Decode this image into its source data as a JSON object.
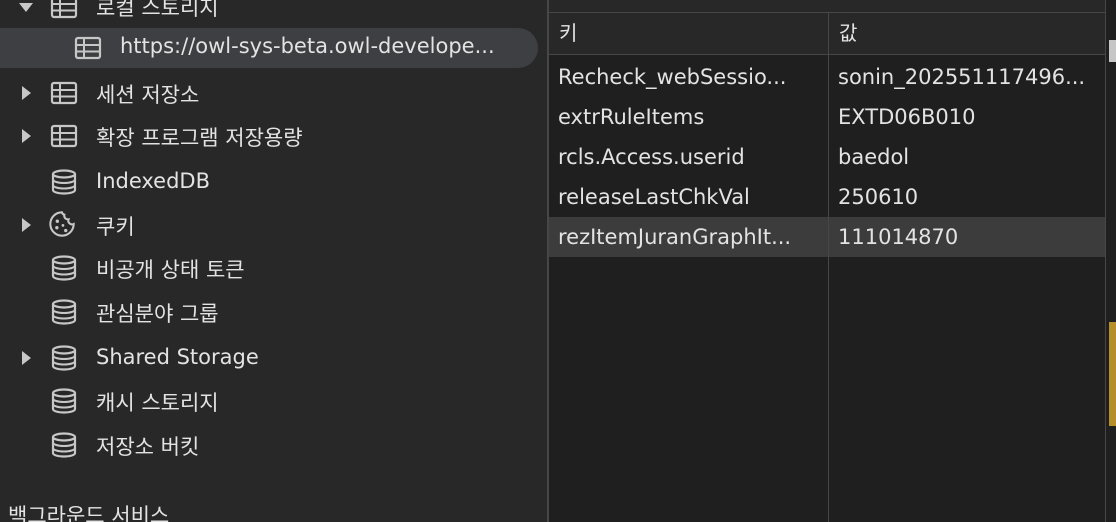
{
  "sidebar": {
    "items": [
      {
        "label": "로컬 스토리지",
        "icon": "table-icon",
        "expander": "down"
      },
      {
        "label": "https://owl-sys-beta.owl-develope...",
        "icon": "table-icon",
        "expander": "none"
      },
      {
        "label": "세션 저장소",
        "icon": "table-icon",
        "expander": "right"
      },
      {
        "label": "확장 프로그램 저장용량",
        "icon": "table-icon",
        "expander": "right"
      },
      {
        "label": "IndexedDB",
        "icon": "database-icon",
        "expander": "none"
      },
      {
        "label": "쿠키",
        "icon": "cookie-icon",
        "expander": "right"
      },
      {
        "label": "비공개 상태 토큰",
        "icon": "database-icon",
        "expander": "none"
      },
      {
        "label": "관심분야 그룹",
        "icon": "database-icon",
        "expander": "none"
      },
      {
        "label": "Shared Storage",
        "icon": "database-icon",
        "expander": "right"
      },
      {
        "label": "캐시 스토리지",
        "icon": "database-icon",
        "expander": "none"
      },
      {
        "label": "저장소 버킷",
        "icon": "database-icon",
        "expander": "none"
      }
    ],
    "section_title": "백그라운드 서비스"
  },
  "table": {
    "columns": [
      "키",
      "값"
    ],
    "rows": [
      {
        "key": "Recheck_webSessio...",
        "value": "sonin_2025511174​96..."
      },
      {
        "key": "extrRuleItems",
        "value": "EXTD06B010"
      },
      {
        "key": "rcls.Access.userid",
        "value": "baedol"
      },
      {
        "key": "releaseLastChkVal",
        "value": "250610"
      },
      {
        "key": "rezItemJuranGraphIt...",
        "value": "111014870"
      }
    ]
  },
  "colors": {
    "background": "#282828",
    "table_background": "#1f1f1f",
    "selected_row": "#3e3f42",
    "highlight_row": "#3c3c3c",
    "border": "#474747",
    "text": "#e3e3e3",
    "accent_scroll": "#b58f2a"
  }
}
